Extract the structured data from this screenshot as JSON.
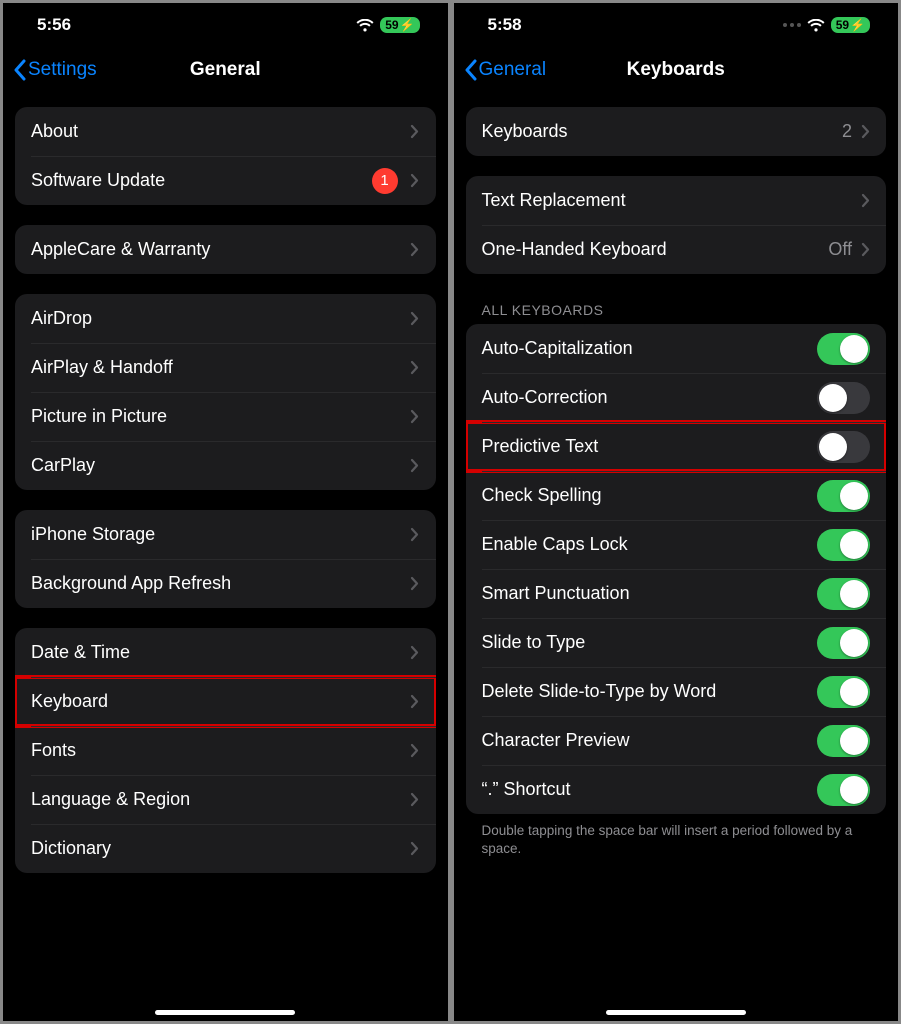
{
  "left": {
    "status_time": "5:56",
    "battery": "59",
    "back_label": "Settings",
    "title": "General",
    "groups": [
      {
        "rows": [
          {
            "key": "about",
            "label": "About"
          },
          {
            "key": "software-update",
            "label": "Software Update",
            "badge": "1"
          }
        ]
      },
      {
        "rows": [
          {
            "key": "applecare",
            "label": "AppleCare & Warranty"
          }
        ]
      },
      {
        "rows": [
          {
            "key": "airdrop",
            "label": "AirDrop"
          },
          {
            "key": "airplay",
            "label": "AirPlay & Handoff"
          },
          {
            "key": "pip",
            "label": "Picture in Picture"
          },
          {
            "key": "carplay",
            "label": "CarPlay"
          }
        ]
      },
      {
        "rows": [
          {
            "key": "storage",
            "label": "iPhone Storage"
          },
          {
            "key": "bg-refresh",
            "label": "Background App Refresh"
          }
        ]
      },
      {
        "rows": [
          {
            "key": "date-time",
            "label": "Date & Time"
          },
          {
            "key": "keyboard",
            "label": "Keyboard",
            "highlight": true
          },
          {
            "key": "fonts",
            "label": "Fonts"
          },
          {
            "key": "language",
            "label": "Language & Region"
          },
          {
            "key": "dictionary",
            "label": "Dictionary"
          }
        ]
      }
    ]
  },
  "right": {
    "status_time": "5:58",
    "battery": "59",
    "back_label": "General",
    "title": "Keyboards",
    "groups_top": [
      {
        "rows": [
          {
            "key": "keyboards",
            "label": "Keyboards",
            "value": "2"
          }
        ]
      },
      {
        "rows": [
          {
            "key": "text-replacement",
            "label": "Text Replacement"
          },
          {
            "key": "one-handed",
            "label": "One-Handed Keyboard",
            "value": "Off"
          }
        ]
      }
    ],
    "all_header": "ALL KEYBOARDS",
    "toggles": [
      {
        "key": "auto-cap",
        "label": "Auto-Capitalization",
        "on": true
      },
      {
        "key": "auto-correct",
        "label": "Auto-Correction",
        "on": false
      },
      {
        "key": "predictive",
        "label": "Predictive Text",
        "on": false,
        "highlight": true
      },
      {
        "key": "spelling",
        "label": "Check Spelling",
        "on": true
      },
      {
        "key": "caps-lock",
        "label": "Enable Caps Lock",
        "on": true
      },
      {
        "key": "smart-punct",
        "label": "Smart Punctuation",
        "on": true
      },
      {
        "key": "slide-type",
        "label": "Slide to Type",
        "on": true
      },
      {
        "key": "delete-slide",
        "label": "Delete Slide-to-Type by Word",
        "on": true
      },
      {
        "key": "char-preview",
        "label": "Character Preview",
        "on": true
      },
      {
        "key": "period-shortcut",
        "label": "“.” Shortcut",
        "on": true
      }
    ],
    "footer": "Double tapping the space bar will insert a period followed by a space."
  }
}
